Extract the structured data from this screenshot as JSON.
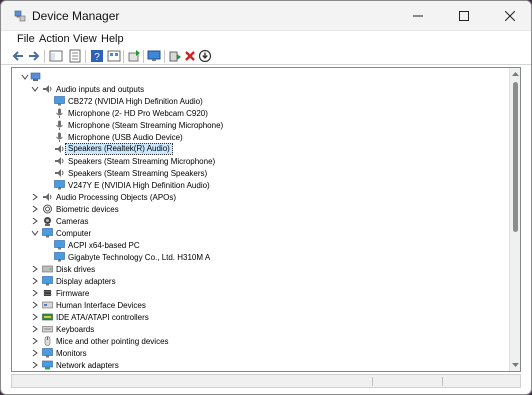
{
  "window": {
    "title": "Device Manager"
  },
  "menu": [
    "File",
    "Action",
    "View",
    "Help"
  ],
  "tree": {
    "root": {
      "expander": "collapse",
      "icon": "computer-icon",
      "label": ""
    },
    "rows": [
      {
        "level": 1,
        "expander": "collapse",
        "icon": "speaker-icon",
        "label": "Audio inputs and outputs"
      },
      {
        "level": 2,
        "expander": "",
        "icon": "monitor-icon",
        "label": "CB272 (NVIDIA High Definition Audio)"
      },
      {
        "level": 2,
        "expander": "",
        "icon": "microphone-icon",
        "label": "Microphone (2- HD Pro Webcam C920)"
      },
      {
        "level": 2,
        "expander": "",
        "icon": "microphone-icon",
        "label": "Microphone (Steam Streaming Microphone)"
      },
      {
        "level": 2,
        "expander": "",
        "icon": "microphone-icon",
        "label": "Microphone (USB Audio Device)"
      },
      {
        "level": 2,
        "expander": "",
        "icon": "speaker-icon",
        "label": "Speakers (Realtek(R) Audio)",
        "selected": true
      },
      {
        "level": 2,
        "expander": "",
        "icon": "speaker-icon",
        "label": "Speakers (Steam Streaming Microphone)"
      },
      {
        "level": 2,
        "expander": "",
        "icon": "speaker-icon",
        "label": "Speakers (Steam Streaming Speakers)"
      },
      {
        "level": 2,
        "expander": "",
        "icon": "monitor-icon",
        "label": "V247Y E (NVIDIA High Definition Audio)"
      },
      {
        "level": 1,
        "expander": "expand",
        "icon": "speaker-icon",
        "label": "Audio Processing Objects (APOs)"
      },
      {
        "level": 1,
        "expander": "expand",
        "icon": "fingerprint-icon",
        "label": "Biometric devices"
      },
      {
        "level": 1,
        "expander": "expand",
        "icon": "camera-icon",
        "label": "Cameras"
      },
      {
        "level": 1,
        "expander": "collapse",
        "icon": "monitor-icon",
        "label": "Computer"
      },
      {
        "level": 2,
        "expander": "",
        "icon": "monitor-icon",
        "label": "ACPI x64-based PC"
      },
      {
        "level": 2,
        "expander": "",
        "icon": "monitor-icon",
        "label": "Gigabyte Technology Co., Ltd. H310M A"
      },
      {
        "level": 1,
        "expander": "expand",
        "icon": "drive-icon",
        "label": "Disk drives"
      },
      {
        "level": 1,
        "expander": "expand",
        "icon": "monitor-icon",
        "label": "Display adapters"
      },
      {
        "level": 1,
        "expander": "expand",
        "icon": "chip-icon",
        "label": "Firmware"
      },
      {
        "level": 1,
        "expander": "expand",
        "icon": "hid-icon",
        "label": "Human Interface Devices"
      },
      {
        "level": 1,
        "expander": "expand",
        "icon": "ide-icon",
        "label": "IDE ATA/ATAPI controllers"
      },
      {
        "level": 1,
        "expander": "expand",
        "icon": "keyboard-icon",
        "label": "Keyboards"
      },
      {
        "level": 1,
        "expander": "expand",
        "icon": "mouse-icon",
        "label": "Mice and other pointing devices"
      },
      {
        "level": 1,
        "expander": "expand",
        "icon": "monitor-icon",
        "label": "Monitors"
      },
      {
        "level": 1,
        "expander": "expand",
        "icon": "network-icon",
        "label": "Network adapters"
      }
    ]
  },
  "colors": {
    "selection_bg": "#cce8ff",
    "accent_blue": "#1e78d7",
    "remove_red": "#d32020",
    "enable_green": "#1c9a2e"
  }
}
